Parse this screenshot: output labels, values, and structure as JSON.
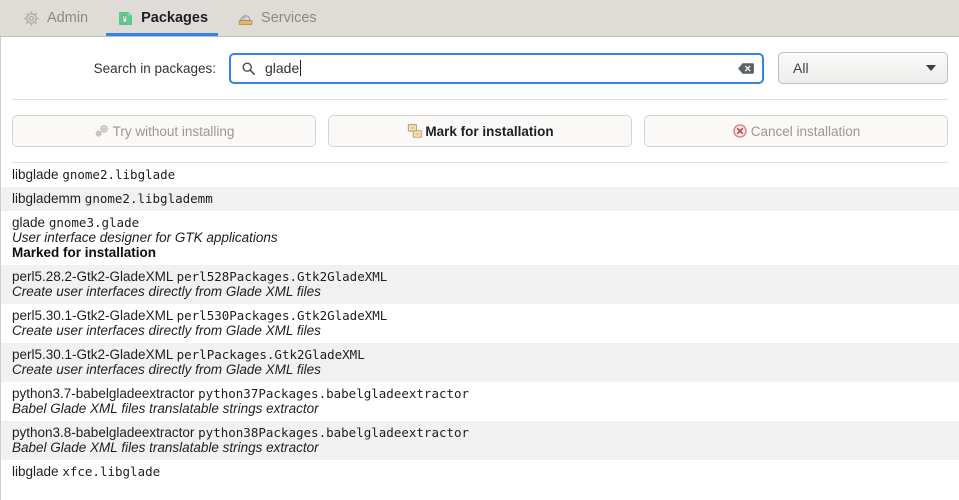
{
  "window": {
    "accent_color": "#3584e4",
    "tabbar_bg": "#dfdcd8",
    "row_alt_bg": "#f1f1f1"
  },
  "tabs": [
    {
      "label": "Admin",
      "icon": "gear-icon",
      "active": false
    },
    {
      "label": "Packages",
      "icon": "package-icon",
      "active": true
    },
    {
      "label": "Services",
      "icon": "services-icon",
      "active": false
    }
  ],
  "search": {
    "label": "Search in packages:",
    "value": "glade",
    "placeholder": "",
    "magnifier_icon": "search-icon",
    "clear_icon": "clear-backspace-icon"
  },
  "filter": {
    "selected": "All",
    "options": [
      "All"
    ]
  },
  "actions": [
    {
      "label": "Try without installing",
      "icon": "gears-icon",
      "state": "disabled"
    },
    {
      "label": "Mark for installation",
      "icon": "copy-boxes-icon",
      "state": "enabled"
    },
    {
      "label": "Cancel installation",
      "icon": "cancel-circle-icon",
      "state": "disabled"
    }
  ],
  "packages": [
    {
      "name": "libglade",
      "attribute": "gnome2.libglade",
      "description": "",
      "status": "",
      "shaded": false
    },
    {
      "name": "libglademm",
      "attribute": "gnome2.libglademm",
      "description": "",
      "status": "",
      "shaded": true
    },
    {
      "name": "glade",
      "attribute": "gnome3.glade",
      "description": "User interface designer for GTK applications",
      "status": "Marked for installation",
      "shaded": false
    },
    {
      "name": "perl5.28.2-Gtk2-GladeXML",
      "attribute": "perl528Packages.Gtk2GladeXML",
      "description": "Create user interfaces directly from Glade XML files",
      "status": "",
      "shaded": true
    },
    {
      "name": "perl5.30.1-Gtk2-GladeXML",
      "attribute": "perl530Packages.Gtk2GladeXML",
      "description": "Create user interfaces directly from Glade XML files",
      "status": "",
      "shaded": false
    },
    {
      "name": "perl5.30.1-Gtk2-GladeXML",
      "attribute": "perlPackages.Gtk2GladeXML",
      "description": "Create user interfaces directly from Glade XML files",
      "status": "",
      "shaded": true
    },
    {
      "name": "python3.7-babelgladeextractor",
      "attribute": "python37Packages.babelgladeextractor",
      "description": "Babel Glade XML files translatable strings extractor",
      "status": "",
      "shaded": false
    },
    {
      "name": "python3.8-babelgladeextractor",
      "attribute": "python38Packages.babelgladeextractor",
      "description": "Babel Glade XML files translatable strings extractor",
      "status": "",
      "shaded": true
    },
    {
      "name": "libglade",
      "attribute": "xfce.libglade",
      "description": "",
      "status": "",
      "shaded": false
    }
  ]
}
